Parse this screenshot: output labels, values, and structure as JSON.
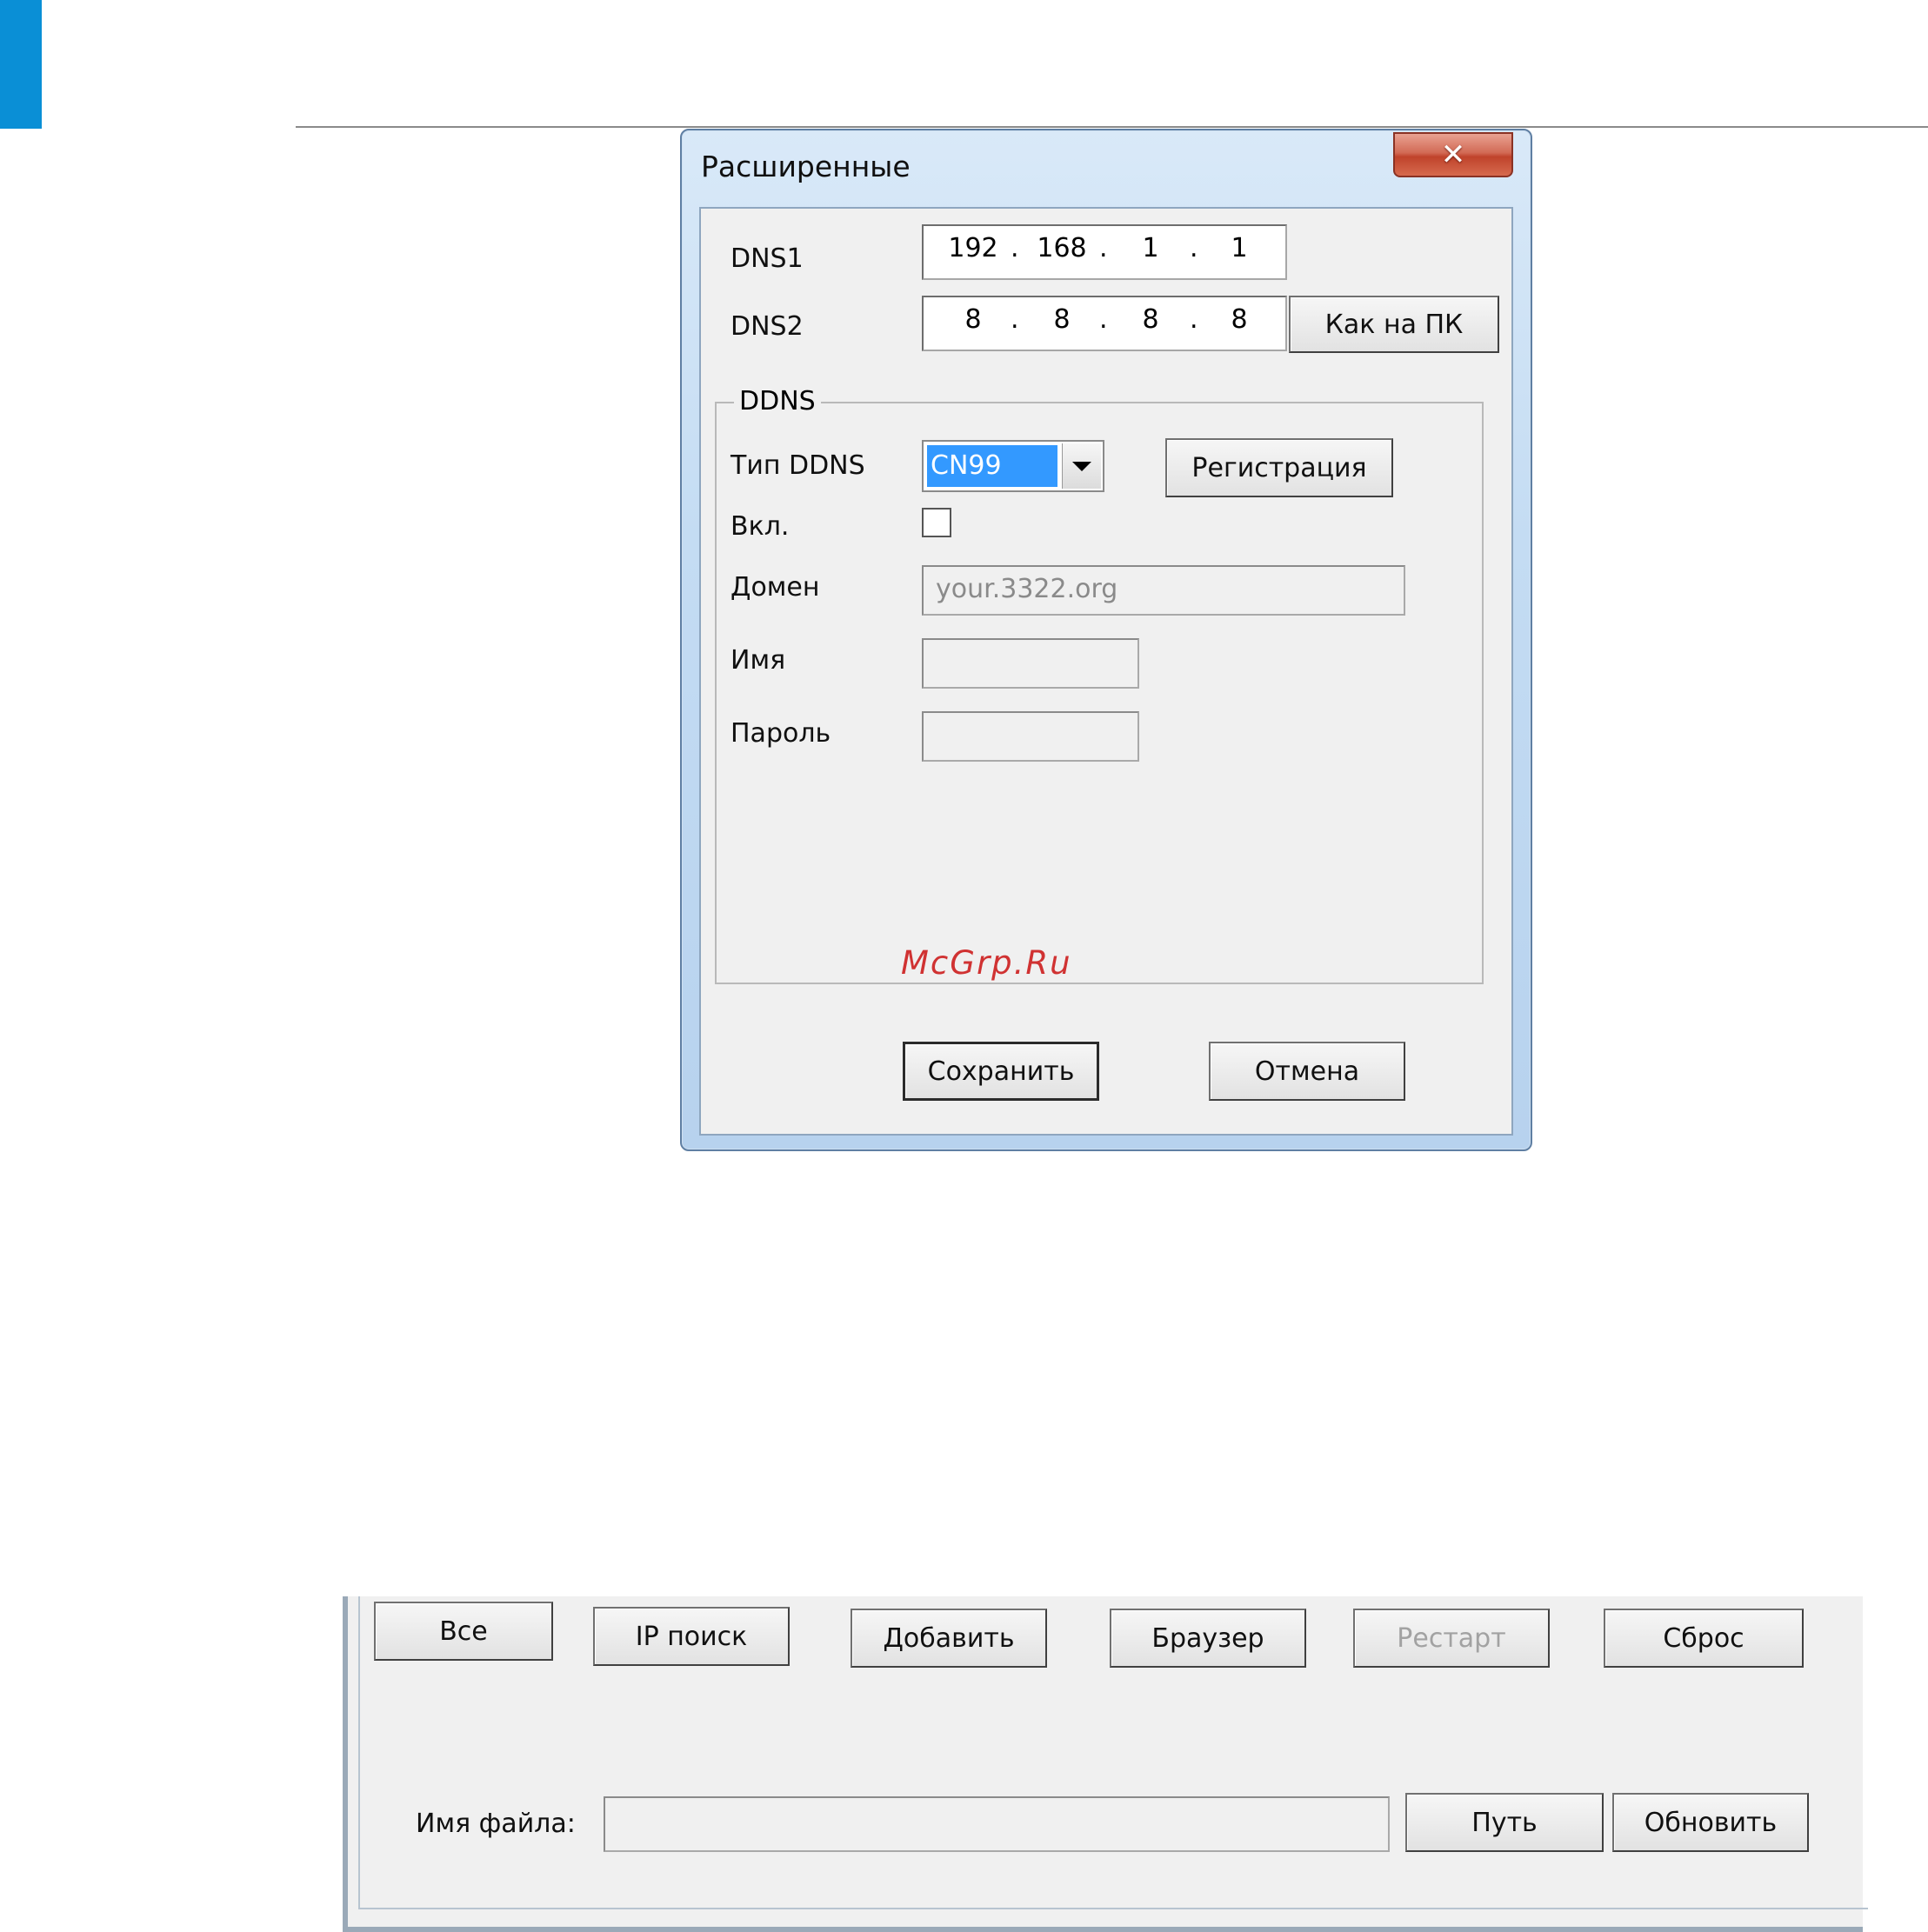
{
  "dialog": {
    "title": "Расширенные",
    "close_glyph": "✕",
    "dns1": {
      "label": "DNS1",
      "octets": [
        "192",
        "168",
        "1",
        "1"
      ]
    },
    "dns2": {
      "label": "DNS2",
      "octets": [
        "8",
        "8",
        "8",
        "8"
      ]
    },
    "as_pc_button": "Как на ПК",
    "ddns": {
      "legend": "DDNS",
      "type_label": "Тип DDNS",
      "type_value": "CN99",
      "register_button": "Регистрация",
      "enable_label": "Вкл.",
      "enabled": false,
      "domain_label": "Домен",
      "domain_value": "your.3322.org",
      "name_label": "Имя",
      "name_value": "",
      "password_label": "Пароль",
      "password_value": ""
    },
    "watermark": "McGrp.Ru",
    "save_button": "Сохранить",
    "cancel_button": "Отмена"
  },
  "panel": {
    "buttons": {
      "all": "Все",
      "ip_search": "IP поиск",
      "add": "Добавить",
      "browser": "Браузер",
      "restart": "Рестарт",
      "reset": "Сброс"
    },
    "filename_label": "Имя файла:",
    "filename_value": "",
    "path_button": "Путь",
    "update_button": "Обновить"
  },
  "colors": {
    "accent": "#0a8fd6",
    "selection": "#3399ff",
    "watermark": "#d03232"
  },
  "icons": {
    "close": "close-icon",
    "dropdown": "chevron-down-icon"
  }
}
